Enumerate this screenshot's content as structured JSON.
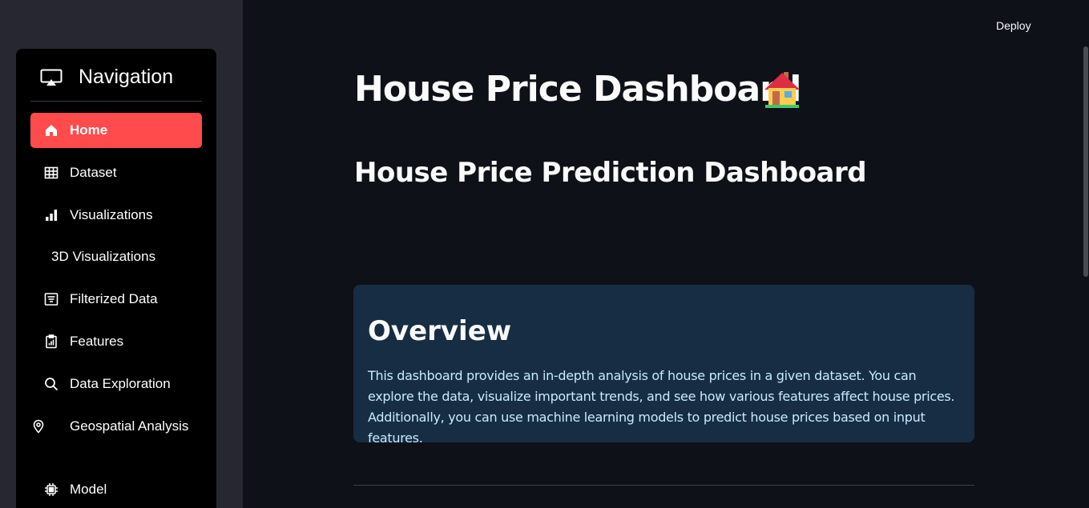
{
  "header": {
    "deploy_label": "Deploy"
  },
  "sidebar": {
    "title": "Navigation",
    "items": [
      {
        "label": "Home",
        "icon": "home-icon",
        "active": true
      },
      {
        "label": "Dataset",
        "icon": "table-icon"
      },
      {
        "label": "Visualizations",
        "icon": "bar-chart-icon"
      },
      {
        "label": "3D Visualizations",
        "icon": ""
      },
      {
        "label": "Filterized Data",
        "icon": "filter-list-icon"
      },
      {
        "label": "Features",
        "icon": "clipboard-chart-icon"
      },
      {
        "label": "Data Exploration",
        "icon": "search-icon"
      },
      {
        "label": "Geospatial Analysis",
        "icon": "map-pin-icon"
      },
      {
        "label": "Model",
        "icon": "cpu-icon"
      }
    ]
  },
  "main": {
    "title": "House Price Dashboard",
    "subtitle": "House Price Prediction Dashboard",
    "overview": {
      "title": "Overview",
      "text": "This dashboard provides an in-depth analysis of house prices in a given dataset. You can explore the data, visualize important trends, and see how various features affect house prices. Additionally, you can use machine learning models to predict house prices based on input features."
    }
  },
  "colors": {
    "background": "#0e1117",
    "sidebar": "#262730",
    "active": "#ff4b4b",
    "overview_bg": "#172d43",
    "overview_text": "#c7ebff"
  }
}
